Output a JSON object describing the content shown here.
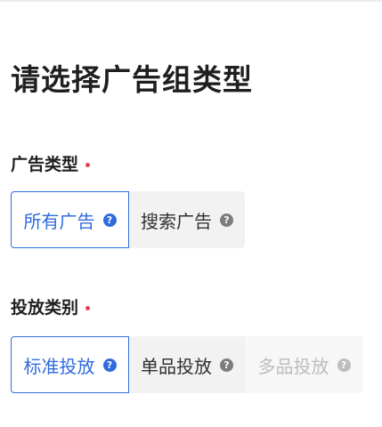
{
  "page": {
    "title": "请选择广告组类型"
  },
  "ad_type": {
    "label": "广告类型",
    "options": [
      {
        "label": "所有广告",
        "state": "selected",
        "icon": "question-circle-icon"
      },
      {
        "label": "搜索广告",
        "state": "default",
        "icon": "question-circle-icon"
      }
    ]
  },
  "placement_category": {
    "label": "投放类别",
    "options": [
      {
        "label": "标准投放",
        "state": "selected",
        "icon": "question-circle-icon"
      },
      {
        "label": "单品投放",
        "state": "default",
        "icon": "question-circle-icon"
      },
      {
        "label": "多品投放",
        "state": "disabled",
        "icon": "question-circle-icon"
      }
    ]
  },
  "icons": {
    "help_glyph": "?"
  },
  "colors": {
    "accent": "#2f6bdc",
    "required": "#e8404a",
    "option_bg": "#f2f2f2",
    "disabled_text": "#bdbdbd"
  }
}
